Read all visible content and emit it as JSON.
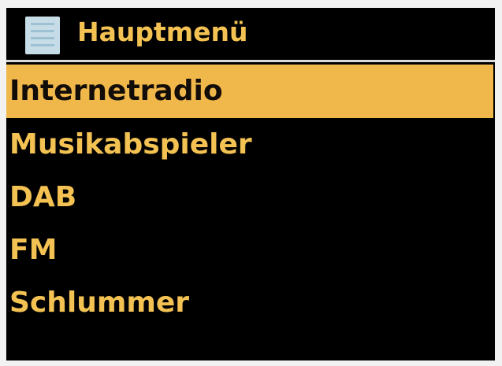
{
  "header": {
    "title": "Hauptmenü",
    "icon": "menu-list-icon"
  },
  "menu": {
    "items": [
      {
        "label": "Internetradio",
        "selected": true
      },
      {
        "label": "Musikabspieler",
        "selected": false
      },
      {
        "label": "DAB",
        "selected": false
      },
      {
        "label": "FM",
        "selected": false
      },
      {
        "label": "Schlummer",
        "selected": false
      }
    ]
  },
  "colors": {
    "background": "#000000",
    "text": "#f3c252",
    "selection": "#f0b74b",
    "icon": "#c6dde8"
  }
}
